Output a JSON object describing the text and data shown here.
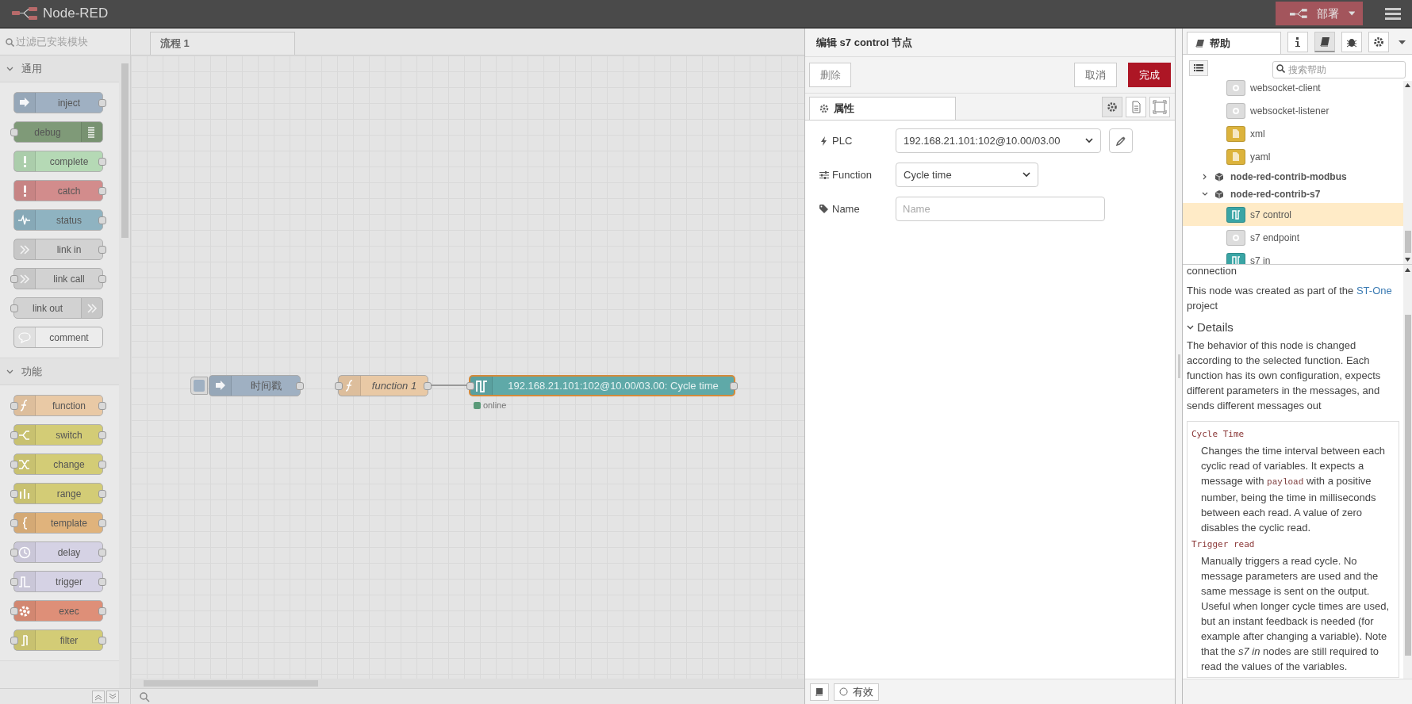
{
  "header": {
    "title": "Node-RED",
    "deploy_label": "部署"
  },
  "palette": {
    "filter_placeholder": "过滤已安装模块",
    "categories": [
      {
        "label": "通用",
        "expanded": true,
        "nodes": [
          {
            "label": "inject",
            "kind": "inject",
            "color": "#9fb0c2",
            "input": false,
            "output": true,
            "icon_right": false
          },
          {
            "label": "debug",
            "kind": "debug",
            "color": "#7f9a78",
            "input": true,
            "output": false,
            "icon_right": true
          },
          {
            "label": "complete",
            "kind": "alert",
            "color": "#b5d9b5",
            "input": false,
            "output": true,
            "icon_right": false
          },
          {
            "label": "catch",
            "kind": "alert",
            "color": "#d28c8c",
            "input": false,
            "output": true,
            "icon_right": false
          },
          {
            "label": "status",
            "kind": "status",
            "color": "#8fb3c1",
            "input": false,
            "output": true,
            "icon_right": false
          },
          {
            "label": "link in",
            "kind": "link",
            "color": "#d2d2d2",
            "input": false,
            "output": true,
            "icon_right": false
          },
          {
            "label": "link call",
            "kind": "link",
            "color": "#d2d2d2",
            "input": true,
            "output": true,
            "icon_right": false
          },
          {
            "label": "link out",
            "kind": "link",
            "color": "#d2d2d2",
            "input": true,
            "output": false,
            "icon_right": true
          },
          {
            "label": "comment",
            "kind": "comment",
            "color": "#ececec",
            "input": false,
            "output": false,
            "icon_right": false
          }
        ]
      },
      {
        "label": "功能",
        "expanded": true,
        "nodes": [
          {
            "label": "function",
            "kind": "function",
            "color": "#e9c9a5",
            "input": true,
            "output": true,
            "icon_right": false
          },
          {
            "label": "switch",
            "kind": "switch",
            "color": "#d3cc76",
            "input": true,
            "output": true,
            "icon_right": false
          },
          {
            "label": "change",
            "kind": "change",
            "color": "#d3cc76",
            "input": true,
            "output": true,
            "icon_right": false
          },
          {
            "label": "range",
            "kind": "range",
            "color": "#d3cc76",
            "input": true,
            "output": true,
            "icon_right": false
          },
          {
            "label": "template",
            "kind": "template",
            "color": "#e0b37c",
            "input": true,
            "output": true,
            "icon_right": false
          },
          {
            "label": "delay",
            "kind": "delay",
            "color": "#d5d2e4",
            "input": true,
            "output": true,
            "icon_right": false
          },
          {
            "label": "trigger",
            "kind": "trigger",
            "color": "#d5d2e4",
            "input": true,
            "output": true,
            "icon_right": false
          },
          {
            "label": "exec",
            "kind": "exec",
            "color": "#de8f78",
            "input": true,
            "output": true,
            "icon_right": false
          },
          {
            "label": "filter",
            "kind": "filter",
            "color": "#d3cc76",
            "input": true,
            "output": true,
            "icon_right": false
          }
        ]
      }
    ]
  },
  "workspace": {
    "tabs": [
      {
        "label": "流程 1",
        "selected": true
      }
    ],
    "nodes": [
      {
        "label": "时间戳",
        "kind": "inject",
        "color": "#9fb0c2",
        "italic": false,
        "selected": false,
        "input": false,
        "output": true
      },
      {
        "label": "function 1",
        "kind": "function",
        "color": "#e9c9a5",
        "italic": true,
        "selected": false,
        "input": true,
        "output": true
      },
      {
        "label": "192.168.21.101:102@10.00/03.00: Cycle time",
        "kind": "s7",
        "color": "#5fa9a8",
        "italic": false,
        "selected": true,
        "input": true,
        "output": true,
        "status": {
          "text": "online",
          "color": "#5a9a78"
        }
      }
    ]
  },
  "editor": {
    "title": "编辑 s7 control 节点",
    "delete_label": "删除",
    "cancel_label": "取消",
    "done_label": "完成",
    "tabs": [
      {
        "label": "属性",
        "selected": true
      }
    ],
    "fields": [
      {
        "label": "PLC",
        "kind": "select",
        "value": "192.168.21.101:102@10.00/03.00",
        "edit_button": true
      },
      {
        "label": "Function",
        "kind": "select",
        "value": "Cycle time",
        "edit_button": false
      },
      {
        "label": "Name",
        "kind": "input",
        "placeholder": "Name"
      }
    ],
    "enabled_label": "有效",
    "enabled": true
  },
  "sidebar": {
    "tabs": [
      {
        "label": "帮助",
        "selected": true
      }
    ],
    "tools": [
      {
        "kind": "info",
        "selected": false
      },
      {
        "kind": "book",
        "selected": true
      },
      {
        "kind": "bug",
        "selected": false
      },
      {
        "kind": "gear",
        "selected": false
      }
    ],
    "search_placeholder": "搜索帮助",
    "tree": {
      "continued": [
        {
          "label": "websocket-client",
          "kind": "config",
          "color": "#dddddd",
          "selected": false
        },
        {
          "label": "websocket-listener",
          "kind": "config",
          "color": "#dddddd",
          "selected": false
        },
        {
          "label": "xml",
          "kind": "doc",
          "color": "#dcb33c",
          "selected": false
        },
        {
          "label": "yaml",
          "kind": "doc",
          "color": "#dcb33c",
          "selected": false
        }
      ],
      "packages": [
        {
          "label": "node-red-contrib-modbus",
          "expanded": false
        },
        {
          "label": "node-red-contrib-s7",
          "expanded": true,
          "children": [
            {
              "label": "s7 control",
              "kind": "s7",
              "color": "#3aa5a5",
              "selected": true
            },
            {
              "label": "s7 endpoint",
              "kind": "config",
              "color": "#dddddd",
              "selected": false
            },
            {
              "label": "s7 in",
              "kind": "s7",
              "color": "#3aa5a5",
              "selected": false
            }
          ]
        }
      ]
    },
    "help": {
      "intro_tail": "connection",
      "credit": {
        "before": "This node was created as part of the ",
        "link": "ST-One",
        "after": " project"
      },
      "details_heading": "Details",
      "details_expanded": true,
      "details_text": "The behavior of this node is changed according to the selected function. Each function has its own configuration, expects different parameters in the messages, and sends different messages out",
      "functions": [
        {
          "term": "Cycle Time",
          "segments": [
            {
              "kind": "text",
              "text": "Changes the time interval between each cyclic read of variables. It expects a message with "
            },
            {
              "kind": "code",
              "text": "payload"
            },
            {
              "kind": "text",
              "text": " with a positive number, being the time in milliseconds between each read. A value of zero disables the cyclic read."
            }
          ]
        },
        {
          "term": "Trigger read",
          "segments": [
            {
              "kind": "text",
              "text": "Manually triggers a read cycle. No message parameters are used and the same message is sent on the output. Useful when longer cycle times are used, but an instant feedback is needed (for example after changing a variable). Note that the *s7 in* nodes are still required to read the values of the variables."
            }
          ]
        }
      ]
    }
  }
}
